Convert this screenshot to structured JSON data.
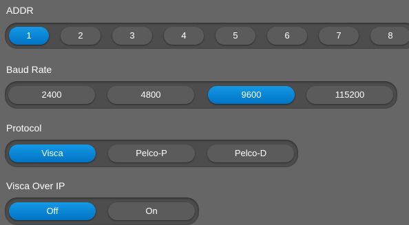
{
  "addr": {
    "label": "ADDR",
    "options": [
      "1",
      "2",
      "3",
      "4",
      "5",
      "6",
      "7",
      "8"
    ],
    "selected": "1"
  },
  "baud_rate": {
    "label": "Baud Rate",
    "options": [
      "2400",
      "4800",
      "9600",
      "115200"
    ],
    "selected": "9600"
  },
  "protocol": {
    "label": "Protocol",
    "options": [
      "Visca",
      "Pelco-P",
      "Pelco-D"
    ],
    "selected": "Visca"
  },
  "visca_over_ip": {
    "label": "Visca Over IP",
    "options": [
      "Off",
      "On"
    ],
    "selected": "Off"
  },
  "colors": {
    "background": "#666666",
    "group_track": "#4d4d4d",
    "option": "#5b5b5b",
    "active": "#0a86d6"
  }
}
